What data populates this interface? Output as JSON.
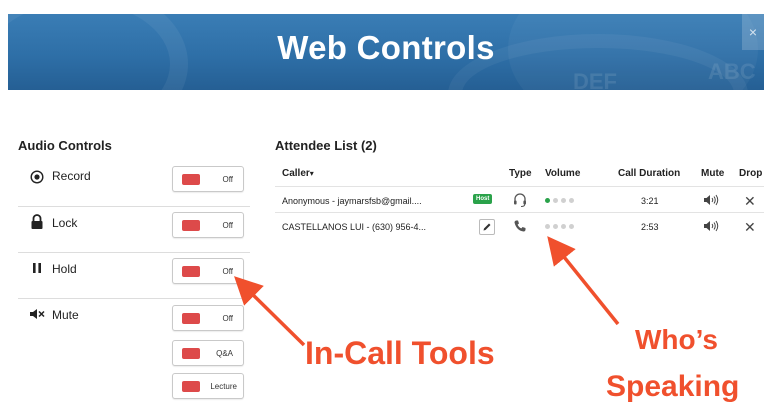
{
  "banner": {
    "title": "Web Controls",
    "close_label": "×",
    "ghost_left": "DEF",
    "ghost_right": "ABC"
  },
  "audio_controls": {
    "title": "Audio Controls",
    "rows": [
      {
        "label": "Record",
        "icon": "record-icon",
        "toggles": [
          "Off"
        ]
      },
      {
        "label": "Lock",
        "icon": "lock-icon",
        "toggles": [
          "Off"
        ]
      },
      {
        "label": "Hold",
        "icon": "pause-icon",
        "toggles": [
          "Off"
        ]
      },
      {
        "label": "Mute",
        "icon": "mute-icon",
        "toggles": [
          "Off",
          "Q&A",
          "Lecture"
        ]
      }
    ]
  },
  "attendees": {
    "title": "Attendee List (2)",
    "columns": {
      "caller": "Caller",
      "sort_indicator": "▾",
      "type": "Type",
      "volume": "Volume",
      "duration": "Call Duration",
      "mute": "Mute",
      "drop": "Drop"
    },
    "rows": [
      {
        "caller": "Anonymous - jaymarsfsb@gmail....",
        "badge": "Host",
        "type": "headset-icon",
        "volume_level": 1,
        "volume_max": 4,
        "duration": "3:21"
      },
      {
        "caller": "CASTELLANOS LUI - (630) 956-4...",
        "badge": "",
        "type": "phone-icon",
        "volume_level": 0,
        "volume_max": 4,
        "duration": "2:53"
      }
    ]
  },
  "annotations": {
    "tools": "In-Call Tools",
    "who_line1": "Who’s",
    "who_line2": "Speaking"
  },
  "colors": {
    "banner": "#2e6fa7",
    "toggle_off": "#dd4a4a",
    "host_badge": "#2aa24a",
    "volume_active": "#2aa24a",
    "annotation": "#f0502d"
  }
}
